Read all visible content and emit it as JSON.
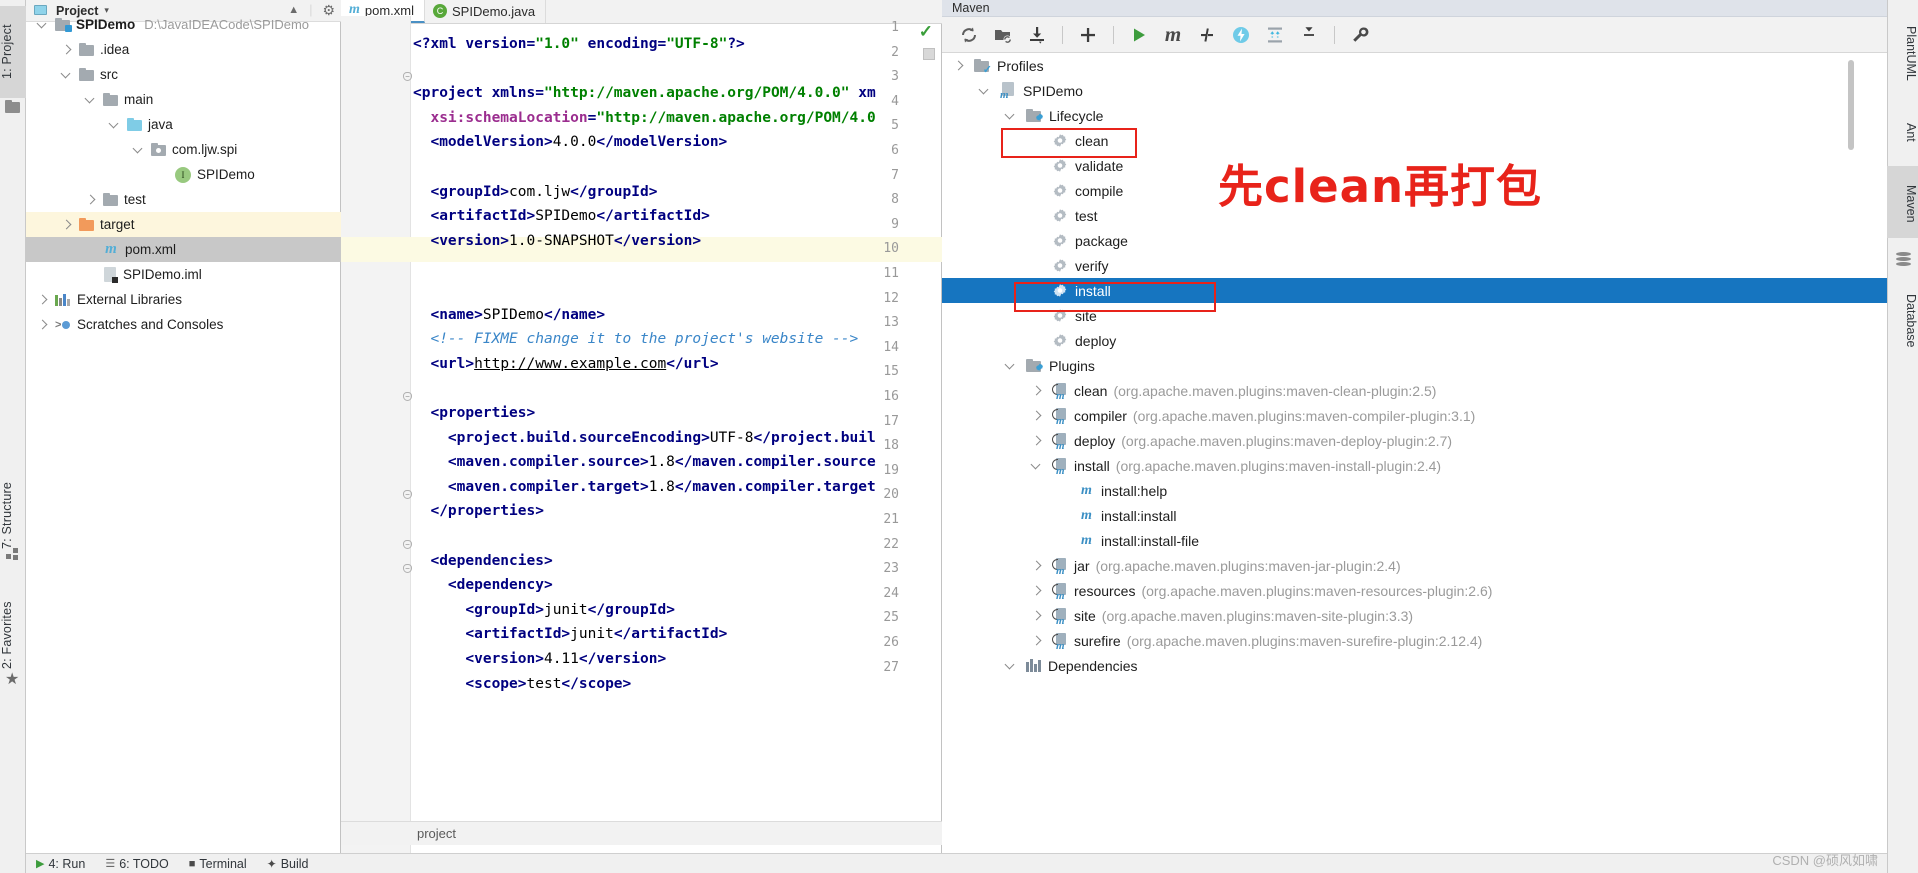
{
  "left_strip": {
    "tabs": [
      {
        "label": "1: Project",
        "icon": "project-icon"
      },
      {
        "label": "7: Structure",
        "icon": "structure-icon"
      },
      {
        "label": "2: Favorites",
        "icon": "favorites-icon"
      }
    ]
  },
  "project_panel": {
    "header": {
      "title": "Project",
      "chevron": "▾",
      "icons": [
        "collapse-icon",
        "hide-icon",
        "gear-icon"
      ]
    },
    "tree": [
      {
        "label": "SPIDemo",
        "path": "D:\\JavaIDEACode\\SPIDemo",
        "icon": "module-folder",
        "arrow": "down",
        "indent": 0,
        "bold": true,
        "highlight": "none"
      },
      {
        "label": ".idea",
        "path": "",
        "icon": "folder",
        "arrow": "right",
        "indent": 1,
        "bold": false,
        "highlight": "none"
      },
      {
        "label": "src",
        "path": "",
        "icon": "folder",
        "arrow": "down",
        "indent": 1,
        "bold": false,
        "highlight": "none"
      },
      {
        "label": "main",
        "path": "",
        "icon": "folder",
        "arrow": "down",
        "indent": 2,
        "bold": false,
        "highlight": "none"
      },
      {
        "label": "java",
        "path": "",
        "icon": "folder-blue",
        "arrow": "down",
        "indent": 3,
        "bold": false,
        "highlight": "none"
      },
      {
        "label": "com.ljw.spi",
        "path": "",
        "icon": "package",
        "arrow": "down",
        "indent": 4,
        "bold": false,
        "highlight": "none"
      },
      {
        "label": "SPIDemo",
        "path": "",
        "icon": "interface",
        "arrow": "none",
        "indent": 5,
        "bold": false,
        "highlight": "none"
      },
      {
        "label": "test",
        "path": "",
        "icon": "folder",
        "arrow": "right",
        "indent": 2,
        "bold": false,
        "highlight": "none"
      },
      {
        "label": "target",
        "path": "",
        "icon": "folder-orange",
        "arrow": "right",
        "indent": 1,
        "bold": false,
        "highlight": "yellow"
      },
      {
        "label": "pom.xml",
        "path": "",
        "icon": "maven-file",
        "arrow": "none",
        "indent": 2,
        "bold": false,
        "highlight": "gray"
      },
      {
        "label": "SPIDemo.iml",
        "path": "",
        "icon": "iml-file",
        "arrow": "none",
        "indent": 2,
        "bold": false,
        "highlight": "none"
      },
      {
        "label": "External Libraries",
        "path": "",
        "icon": "libraries",
        "arrow": "right",
        "indent": 0,
        "bold": false,
        "highlight": "none"
      },
      {
        "label": "Scratches and Consoles",
        "path": "",
        "icon": "scratches",
        "arrow": "right",
        "indent": 0,
        "bold": false,
        "highlight": "none"
      }
    ]
  },
  "editor": {
    "tabs": [
      {
        "label": "pom.xml",
        "icon": "maven-file-icon",
        "active": true
      },
      {
        "label": "SPIDemo.java",
        "icon": "java-class-icon",
        "active": false
      }
    ],
    "breadcrumb": "project",
    "status_icon": "inspection-ok-check",
    "lines": [
      {
        "n": 1,
        "fold": "",
        "html": "<span class=\"tag\">&lt;?xml </span><span class=\"attr\">version</span><span class=\"tag\">=</span><span class=\"val\">\"1.0\"</span> <span class=\"attr\">encoding</span><span class=\"tag\">=</span><span class=\"val\">\"UTF-8\"</span><span class=\"tag\">?&gt;</span>"
      },
      {
        "n": 2,
        "fold": "",
        "html": ""
      },
      {
        "n": 3,
        "fold": "-",
        "html": "<span class=\"tag\">&lt;project </span><span class=\"attr\">xmlns</span><span class=\"tag\">=</span><span class=\"val\">\"http://maven.apache.org/POM/4.0.0\"</span> <span class=\"attr\">xm</span>"
      },
      {
        "n": 4,
        "fold": "",
        "html": "  <span class=\"ns\">xsi:schemaLocation</span><span class=\"tag\">=</span><span class=\"val\">\"http://maven.apache.org/POM/4.0</span>"
      },
      {
        "n": 5,
        "fold": "",
        "html": "  <span class=\"tag\">&lt;modelVersion&gt;</span><span class=\"txt\">4.0.0</span><span class=\"tag\">&lt;/modelVersion&gt;</span>"
      },
      {
        "n": 6,
        "fold": "",
        "html": ""
      },
      {
        "n": 7,
        "fold": "",
        "html": "  <span class=\"tag\">&lt;groupId&gt;</span><span class=\"txt\">com.ljw</span><span class=\"tag\">&lt;/groupId&gt;</span>"
      },
      {
        "n": 8,
        "fold": "",
        "html": "  <span class=\"tag\">&lt;artifactId&gt;</span><span class=\"txt\">SPIDemo</span><span class=\"tag\">&lt;/artifactId&gt;</span>"
      },
      {
        "n": 9,
        "fold": "",
        "html": "  <span class=\"tag\">&lt;version&gt;</span><span class=\"txt\">1.0-SNAPSHOT</span><span class=\"tag\">&lt;/version&gt;</span>"
      },
      {
        "n": 10,
        "fold": "",
        "html": ""
      },
      {
        "n": 11,
        "fold": "",
        "html": ""
      },
      {
        "n": 12,
        "fold": "",
        "html": "  <span class=\"tag\">&lt;name&gt;</span><span class=\"txt\">SPIDemo</span><span class=\"tag\">&lt;/name&gt;</span>"
      },
      {
        "n": 13,
        "fold": "",
        "html": "  <span class=\"cmt\">&lt;!-- FIXME change it to the project's website --&gt;</span>"
      },
      {
        "n": 14,
        "fold": "",
        "html": "  <span class=\"tag\">&lt;url&gt;</span><span class=\"lnk\">http://www.example.com</span><span class=\"tag\">&lt;/url&gt;</span>"
      },
      {
        "n": 15,
        "fold": "",
        "html": ""
      },
      {
        "n": 16,
        "fold": "-",
        "html": "  <span class=\"tag\">&lt;properties&gt;</span>"
      },
      {
        "n": 17,
        "fold": "",
        "html": "    <span class=\"tag\">&lt;project.build.sourceEncoding&gt;</span><span class=\"txt\">UTF-8</span><span class=\"tag\">&lt;/project.buil</span>"
      },
      {
        "n": 18,
        "fold": "",
        "html": "    <span class=\"tag\">&lt;maven.compiler.source&gt;</span><span class=\"txt\">1.8</span><span class=\"tag\">&lt;/maven.compiler.source</span>"
      },
      {
        "n": 19,
        "fold": "",
        "html": "    <span class=\"tag\">&lt;maven.compiler.target&gt;</span><span class=\"txt\">1.8</span><span class=\"tag\">&lt;/maven.compiler.target</span>"
      },
      {
        "n": 20,
        "fold": "+",
        "html": "  <span class=\"tag\">&lt;/properties&gt;</span>"
      },
      {
        "n": 21,
        "fold": "",
        "html": ""
      },
      {
        "n": 22,
        "fold": "-",
        "html": "  <span class=\"tag\">&lt;dependencies&gt;</span>"
      },
      {
        "n": 23,
        "fold": "-",
        "html": "    <span class=\"tag\">&lt;dependency&gt;</span>"
      },
      {
        "n": 24,
        "fold": "",
        "html": "      <span class=\"tag\">&lt;groupId&gt;</span><span class=\"txt\">junit</span><span class=\"tag\">&lt;/groupId&gt;</span>"
      },
      {
        "n": 25,
        "fold": "",
        "html": "      <span class=\"tag\">&lt;artifactId&gt;</span><span class=\"txt\">junit</span><span class=\"tag\">&lt;/artifactId&gt;</span>"
      },
      {
        "n": 26,
        "fold": "",
        "html": "      <span class=\"tag\">&lt;version&gt;</span><span class=\"txt\">4.11</span><span class=\"tag\">&lt;/version&gt;</span>"
      },
      {
        "n": 27,
        "fold": "",
        "html": "      <span class=\"tag\">&lt;scope&gt;</span><span class=\"txt\">test</span><span class=\"tag\">&lt;/scope&gt;</span>"
      }
    ],
    "highlight_line": 10
  },
  "maven": {
    "title": "Maven",
    "toolbar": [
      {
        "name": "reimport-icon",
        "glyph": "refresh"
      },
      {
        "name": "generate-sources-icon",
        "glyph": "folder-refresh"
      },
      {
        "name": "download-sources-icon",
        "glyph": "download"
      },
      {
        "name": "add-maven-project-icon",
        "glyph": "plus"
      },
      {
        "name": "run-icon",
        "glyph": "play"
      },
      {
        "name": "execute-maven-goal-icon",
        "glyph": "m"
      },
      {
        "name": "toggle-skip-tests-icon",
        "glyph": "skip-tests"
      },
      {
        "name": "toggle-offline-icon",
        "glyph": "bolt"
      },
      {
        "name": "expand-all-icon",
        "glyph": "expand"
      },
      {
        "name": "collapse-all-icon",
        "glyph": "collapse"
      },
      {
        "name": "maven-settings-icon",
        "glyph": "wrench"
      }
    ],
    "tree": [
      {
        "label": "Profiles",
        "coord": "",
        "icon": "profiles-folder",
        "arrow": "right",
        "indent": 0,
        "state": "normal"
      },
      {
        "label": "SPIDemo",
        "coord": "",
        "icon": "maven-module",
        "arrow": "down",
        "indent": 1,
        "state": "normal"
      },
      {
        "label": "Lifecycle",
        "coord": "",
        "icon": "lifecycle-folder",
        "arrow": "down",
        "indent": 2,
        "state": "normal"
      },
      {
        "label": "clean",
        "coord": "",
        "icon": "goal-gear",
        "arrow": "none",
        "indent": 3,
        "state": "boxed"
      },
      {
        "label": "validate",
        "coord": "",
        "icon": "goal-gear",
        "arrow": "none",
        "indent": 3,
        "state": "normal"
      },
      {
        "label": "compile",
        "coord": "",
        "icon": "goal-gear",
        "arrow": "none",
        "indent": 3,
        "state": "normal"
      },
      {
        "label": "test",
        "coord": "",
        "icon": "goal-gear",
        "arrow": "none",
        "indent": 3,
        "state": "normal"
      },
      {
        "label": "package",
        "coord": "",
        "icon": "goal-gear",
        "arrow": "none",
        "indent": 3,
        "state": "normal"
      },
      {
        "label": "verify",
        "coord": "",
        "icon": "goal-gear",
        "arrow": "none",
        "indent": 3,
        "state": "normal"
      },
      {
        "label": "install",
        "coord": "",
        "icon": "goal-gear",
        "arrow": "none",
        "indent": 3,
        "state": "selected-boxed"
      },
      {
        "label": "site",
        "coord": "",
        "icon": "goal-gear",
        "arrow": "none",
        "indent": 3,
        "state": "normal"
      },
      {
        "label": "deploy",
        "coord": "",
        "icon": "goal-gear",
        "arrow": "none",
        "indent": 3,
        "state": "normal"
      },
      {
        "label": "Plugins",
        "coord": "",
        "icon": "plugins-folder",
        "arrow": "down",
        "indent": 2,
        "state": "normal"
      },
      {
        "label": "clean",
        "coord": "(org.apache.maven.plugins:maven-clean-plugin:2.5)",
        "icon": "plugin",
        "arrow": "right",
        "indent": 3,
        "state": "normal"
      },
      {
        "label": "compiler",
        "coord": "(org.apache.maven.plugins:maven-compiler-plugin:3.1)",
        "icon": "plugin",
        "arrow": "right",
        "indent": 3,
        "state": "normal"
      },
      {
        "label": "deploy",
        "coord": "(org.apache.maven.plugins:maven-deploy-plugin:2.7)",
        "icon": "plugin",
        "arrow": "right",
        "indent": 3,
        "state": "normal"
      },
      {
        "label": "install",
        "coord": "(org.apache.maven.plugins:maven-install-plugin:2.4)",
        "icon": "plugin",
        "arrow": "down",
        "indent": 3,
        "state": "normal"
      },
      {
        "label": "install:help",
        "coord": "",
        "icon": "plugin-goal",
        "arrow": "none",
        "indent": 4,
        "state": "normal"
      },
      {
        "label": "install:install",
        "coord": "",
        "icon": "plugin-goal",
        "arrow": "none",
        "indent": 4,
        "state": "normal"
      },
      {
        "label": "install:install-file",
        "coord": "",
        "icon": "plugin-goal",
        "arrow": "none",
        "indent": 4,
        "state": "normal"
      },
      {
        "label": "jar",
        "coord": "(org.apache.maven.plugins:maven-jar-plugin:2.4)",
        "icon": "plugin",
        "arrow": "right",
        "indent": 3,
        "state": "normal"
      },
      {
        "label": "resources",
        "coord": "(org.apache.maven.plugins:maven-resources-plugin:2.6)",
        "icon": "plugin",
        "arrow": "right",
        "indent": 3,
        "state": "normal"
      },
      {
        "label": "site",
        "coord": "(org.apache.maven.plugins:maven-site-plugin:3.3)",
        "icon": "plugin",
        "arrow": "right",
        "indent": 3,
        "state": "normal"
      },
      {
        "label": "surefire",
        "coord": "(org.apache.maven.plugins:maven-surefire-plugin:2.12.4)",
        "icon": "plugin",
        "arrow": "right",
        "indent": 3,
        "state": "normal"
      },
      {
        "label": "Dependencies",
        "coord": "",
        "icon": "dependencies",
        "arrow": "down",
        "indent": 2,
        "state": "normal"
      }
    ]
  },
  "annotation": {
    "text": "先clean再打包",
    "color": "#e8231a"
  },
  "right_strip": {
    "tabs": [
      {
        "label": "PlantUML"
      },
      {
        "label": "Ant"
      },
      {
        "label": "Maven"
      },
      {
        "label": "Database"
      }
    ]
  },
  "bottom_bar": {
    "items": [
      {
        "label": "4: Run",
        "icon": "run-icon"
      },
      {
        "label": "6: TODO",
        "icon": "todo-icon"
      },
      {
        "label": "Terminal",
        "icon": "terminal-icon"
      },
      {
        "label": "Build",
        "icon": "build-icon"
      }
    ]
  },
  "watermark": "CSDN @硕风如啸",
  "colors": {
    "selection_blue": "#1675c0",
    "annotation_red": "#e8231a",
    "highlight_yellow": "#fdf6dd",
    "maven_header": "#dfe3ea"
  }
}
